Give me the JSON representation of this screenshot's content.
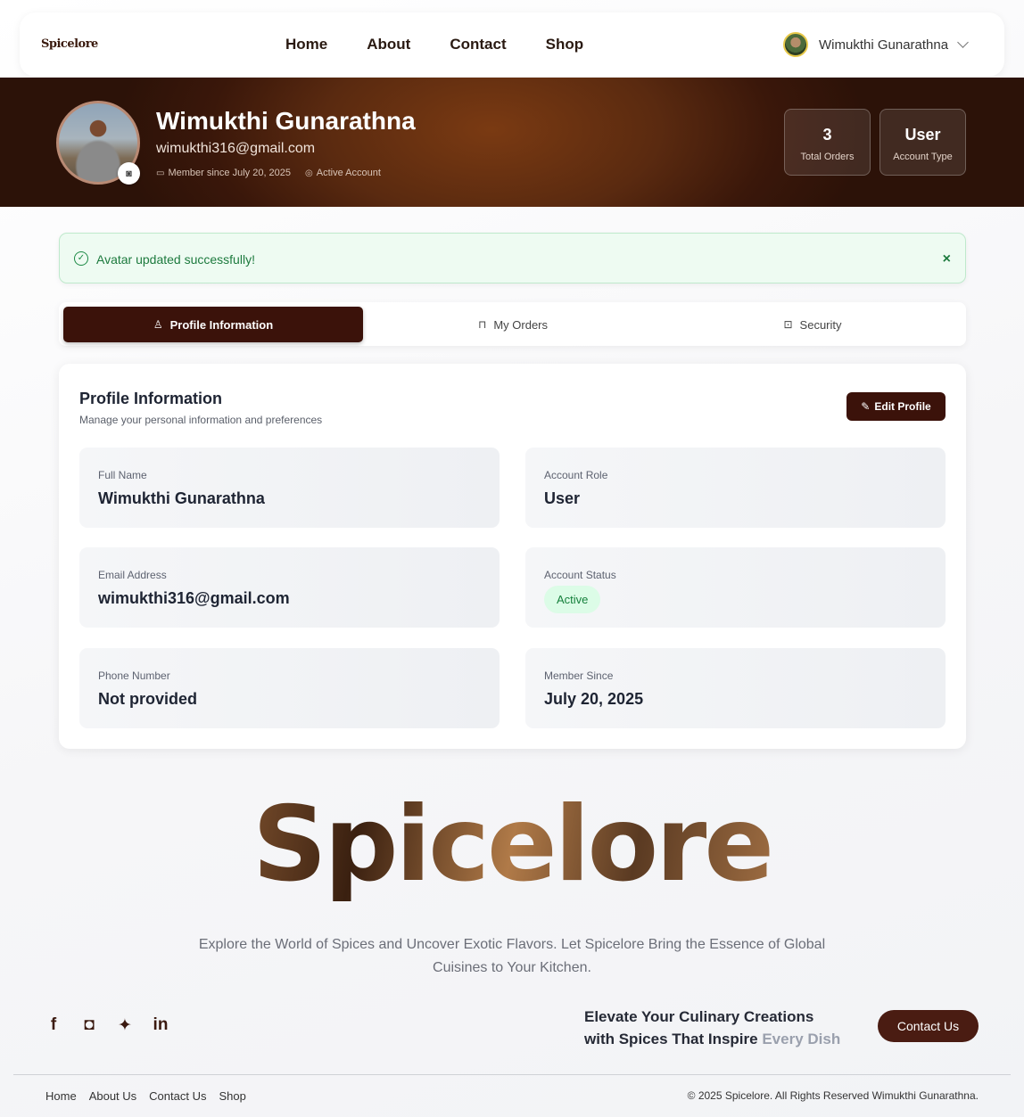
{
  "navbar": {
    "logo": "Spicelore",
    "links": [
      "Home",
      "About",
      "Contact",
      "Shop"
    ],
    "user_name": "Wimukthi Gunarathna"
  },
  "hero": {
    "name": "Wimukthi Gunarathna",
    "email": "wimukthi316@gmail.com",
    "member_since": "Member since July 20, 2025",
    "status": "Active Account",
    "stats": [
      {
        "value": "3",
        "label": "Total Orders"
      },
      {
        "value": "User",
        "label": "Account Type"
      }
    ]
  },
  "alert": {
    "message": "Avatar updated successfully!",
    "close": "×"
  },
  "tabs": [
    {
      "label": "Profile Information",
      "icon": "user-icon"
    },
    {
      "label": "My Orders",
      "icon": "bag-icon"
    },
    {
      "label": "Security",
      "icon": "lock-icon"
    }
  ],
  "profile": {
    "title": "Profile Information",
    "subtitle": "Manage your personal information and preferences",
    "edit_label": "Edit Profile",
    "fields": [
      {
        "label": "Full Name",
        "value": "Wimukthi Gunarathna"
      },
      {
        "label": "Account Role",
        "value": "User"
      },
      {
        "label": "Email Address",
        "value": "wimukthi316@gmail.com"
      },
      {
        "label": "Account Status",
        "value": "Active"
      },
      {
        "label": "Phone Number",
        "value": "Not provided"
      },
      {
        "label": "Member Since",
        "value": "July 20, 2025"
      }
    ]
  },
  "footer": {
    "brand": "Spicelore",
    "tagline": "Explore the World of Spices and Uncover Exotic Flavors. Let Spicelore Bring the Essence of Global Cuisines to Your Kitchen.",
    "cta_line1": "Elevate Your Culinary Creations",
    "cta_line2": "with Spices That Inspire",
    "cta_highlight": "Every Dish",
    "contact_button": "Contact Us",
    "socials": [
      "facebook-icon",
      "instagram-icon",
      "twitter-icon",
      "linkedin-icon"
    ],
    "links": [
      "Home",
      "About Us",
      "Contact Us",
      "Shop"
    ],
    "copyright": "© 2025 Spicelore. All Rights Reserved Wimukthi Gunarathna."
  },
  "colors": {
    "brand": "#3b120a",
    "success": "#16803c"
  }
}
